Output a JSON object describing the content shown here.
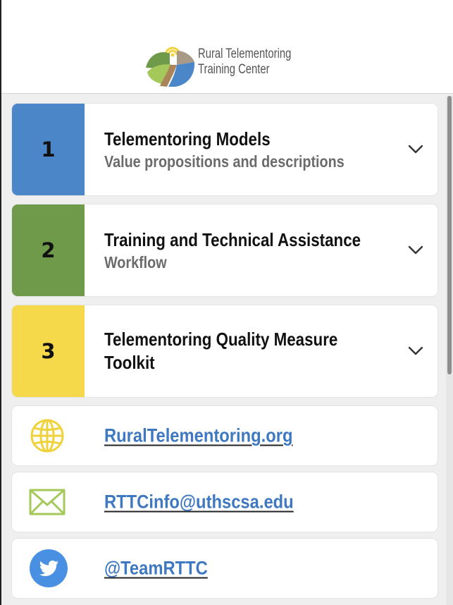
{
  "header": {
    "logo_line1": "Rural Telementoring",
    "logo_line2": "Training Center"
  },
  "sections": [
    {
      "number": "1",
      "title": "Telementoring Models",
      "subtitle": "Value propositions and descriptions",
      "color": "#4a86c8"
    },
    {
      "number": "2",
      "title": "Training and Technical Assistance",
      "subtitle": "Workflow",
      "color": "#6e9a4a"
    },
    {
      "number": "3",
      "title": "Telementoring Quality Measure Toolkit",
      "subtitle": "",
      "color": "#f5d94a"
    }
  ],
  "links": [
    {
      "icon": "globe-icon",
      "text": "RuralTelementoring.org",
      "color": "#f0d23c"
    },
    {
      "icon": "mail-icon",
      "text": "RTTCinfo@uthscsa.edu",
      "color": "#a5c85a"
    },
    {
      "icon": "twitter-icon",
      "text": "@TeamRTTC",
      "color": "#4a90e2"
    }
  ],
  "colors": {
    "link": "#3e78c0",
    "background": "#efefef"
  }
}
